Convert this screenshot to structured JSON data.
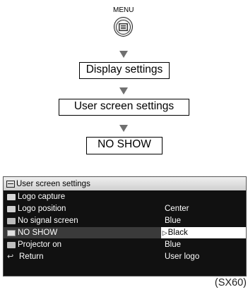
{
  "flow": {
    "menu_label": "MENU",
    "steps": [
      "Display settings",
      "User screen settings",
      "NO SHOW"
    ]
  },
  "osd": {
    "title": "User screen settings",
    "rows": [
      {
        "icon": "image-icon",
        "label": "Logo capture",
        "value": ""
      },
      {
        "icon": "logo-position-icon",
        "label": "Logo position",
        "value": "Center"
      },
      {
        "icon": "no-signal-icon",
        "label": "No signal screen",
        "value": "Blue"
      },
      {
        "icon": "no-show-icon",
        "label": "NO SHOW",
        "value": "Black",
        "selected": true,
        "pointer": "▷"
      },
      {
        "icon": "projector-icon",
        "label": "Projector on",
        "value": "Blue"
      },
      {
        "icon": "return-icon",
        "label": "Return",
        "value": "User logo"
      }
    ]
  },
  "footnote": "(SX60)"
}
